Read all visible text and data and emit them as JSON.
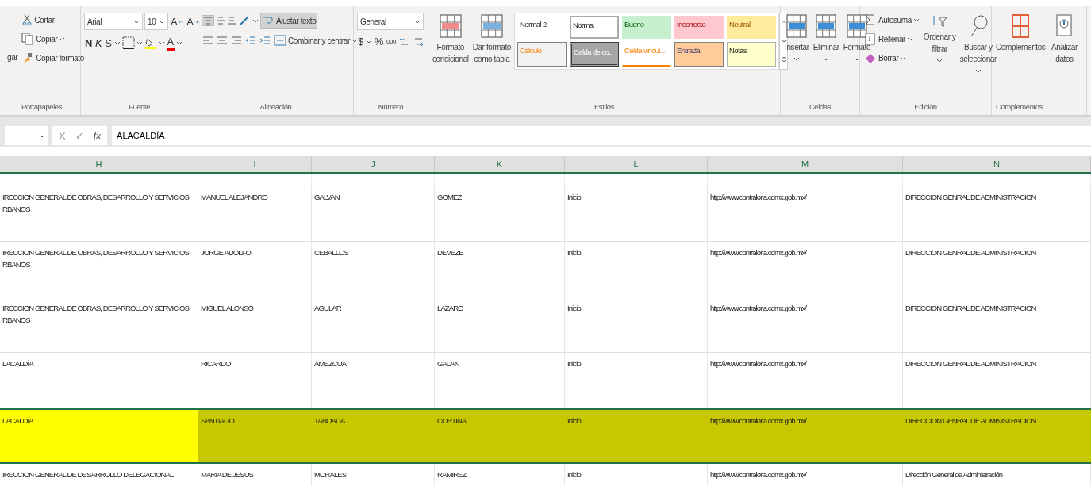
{
  "ribbon": {
    "groups": [
      {
        "kind": "clipboard",
        "label": "Portapapeles",
        "paste_label": "gar",
        "items": [
          "Cortar",
          "Copiar",
          "Copiar formato"
        ]
      },
      {
        "kind": "font",
        "label": "Fuente",
        "font": "Arial",
        "size": "10",
        "bold": "N",
        "italic": "K",
        "underline": "S",
        "font_color": "A",
        "grow": "A",
        "shrink": "A"
      },
      {
        "kind": "alignment",
        "label": "Alineación",
        "wrap": {
          "label": "Ajustar texto",
          "on": true
        },
        "top_align_on": true,
        "merge": "Combinar y centrar"
      },
      {
        "kind": "number",
        "label": "Número",
        "format": "General",
        "currency": "$",
        "percent": "%",
        "thousands": "000"
      },
      {
        "kind": "styles",
        "label": "Estilos",
        "conditional": [
          "Formato",
          "condicional"
        ],
        "as_table": [
          "Dar formato",
          "como tabla"
        ],
        "styles": [
          {
            "label": "Normal 2",
            "kind": "plain"
          },
          {
            "label": "Normal",
            "kind": "normal"
          },
          {
            "label": "Bueno",
            "kind": "good"
          },
          {
            "label": "Incorrecto",
            "kind": "bad"
          },
          {
            "label": "Neutral",
            "kind": "neutral"
          },
          {
            "label": "Cálculo",
            "kind": "calc"
          },
          {
            "label": "Celda de co...",
            "kind": "check"
          },
          {
            "label": "Celda vincul...",
            "kind": "linked"
          },
          {
            "label": "Entrada",
            "kind": "input"
          },
          {
            "label": "Notas",
            "kind": "note"
          }
        ]
      },
      {
        "kind": "cells",
        "label": "Celdas",
        "items": [
          "Insertar",
          "Eliminar",
          "Formato"
        ]
      },
      {
        "kind": "editing",
        "label": "Edición",
        "items": [
          "Autosuma",
          "Rellenar",
          "Borrar"
        ],
        "sort": [
          "Ordenar y",
          "filtrar"
        ],
        "find": [
          "Buscar y",
          "seleccionar"
        ]
      },
      {
        "kind": "addins",
        "label": "Complementos",
        "button": "Complementos"
      },
      {
        "kind": "analyze",
        "button": [
          "Analizar",
          "datos"
        ]
      }
    ]
  },
  "formula_bar": {
    "cancel": "X",
    "enter": "✓",
    "fx": "fx",
    "value": "ALACALDÍA"
  },
  "table": {
    "columns": [
      "H",
      "I",
      "J",
      "K",
      "L",
      "M",
      "N"
    ],
    "rows": [
      {
        "selected": false,
        "cells": [
          [
            "IRECCION GENERAL DE OBRAS, DESARROLLO Y SERVICIOS",
            "RBANOS"
          ],
          [
            "MANUEL ALEJANDRO"
          ],
          [
            "GALVAN"
          ],
          [
            "GOMEZ"
          ],
          [
            "Inicio"
          ],
          [
            "http://www.contraloria.cdmx.gob.mx/"
          ],
          [
            "DIRECCION GENRAL DE ADMINISTRACION"
          ]
        ]
      },
      {
        "selected": false,
        "cells": [
          [
            "IRECCION GENERAL DE OBRAS, DESARROLLO Y SERVICIOS",
            "RBANOS"
          ],
          [
            "JORGE ADOLFO"
          ],
          [
            "CEBALLOS"
          ],
          [
            "DEVEZE"
          ],
          [
            "Inicio"
          ],
          [
            "http://www.contraloria.cdmx.gob.mx/"
          ],
          [
            "DIRECCION GENRAL DE ADMINISTRACION"
          ]
        ]
      },
      {
        "selected": false,
        "cells": [
          [
            "IRECCION GENERAL DE OBRAS, DESARROLLO Y SERVICIOS",
            "RBANOS"
          ],
          [
            "MIGUEL ALONSO"
          ],
          [
            "AGULAR"
          ],
          [
            "LAZARO"
          ],
          [
            "Inicio"
          ],
          [
            "http://www.contraloria.cdmx.gob.mx/"
          ],
          [
            "DIRECCION GENRAL DE ADMINISTRACION"
          ]
        ]
      },
      {
        "selected": false,
        "cells": [
          [
            "LACALDÍA"
          ],
          [
            "RICARDO"
          ],
          [
            "AMEZCUA"
          ],
          [
            "GALAN"
          ],
          [
            "Inicio"
          ],
          [
            "http://www.contraloria.cdmx.gob.mx/"
          ],
          [
            "DIRECCION GENRAL DE ADMINISTRACION"
          ]
        ]
      },
      {
        "selected": true,
        "cells": [
          [
            "LACALDÍA"
          ],
          [
            "SANTIAGO"
          ],
          [
            "TABOADA"
          ],
          [
            "CORTINA"
          ],
          [
            "Inicio"
          ],
          [
            "http://www.contraloria.cdmx.gob.mx/"
          ],
          [
            "DIRECCION GENRAL DE ADMINISTRACION"
          ]
        ]
      },
      {
        "selected": false,
        "cells": [
          [
            "IRECCION GENERAL DE DESARROLLO DELEGACIONAL"
          ],
          [
            "MARIA DE JESUS"
          ],
          [
            "MORALES"
          ],
          [
            "RAMIREZ"
          ],
          [
            "Inicio"
          ],
          [
            "http://www.contraloria.cdmx.gob.mx/"
          ],
          [
            "Dirección General de Administración"
          ]
        ]
      }
    ]
  }
}
